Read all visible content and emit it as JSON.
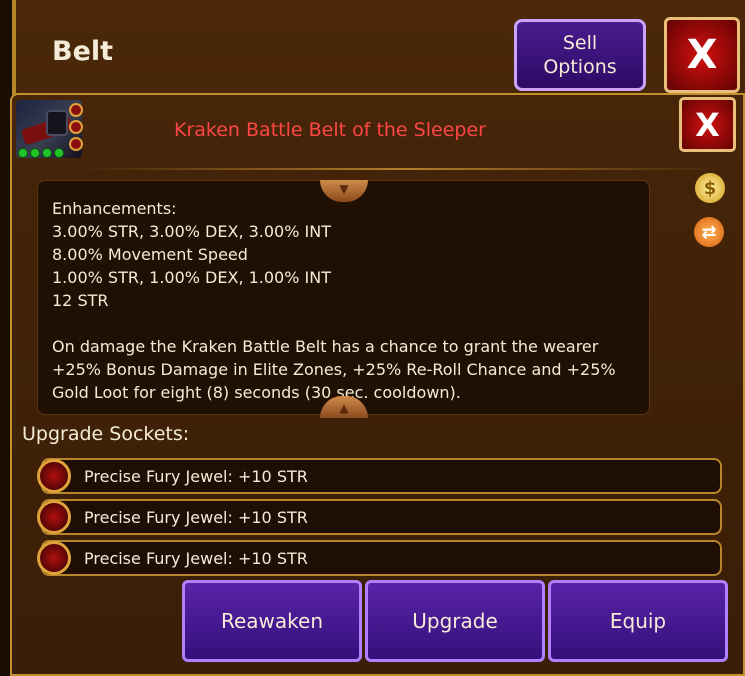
{
  "header": {
    "title": "Belt",
    "sell_label": "Sell\nOptions",
    "close_label": "X"
  },
  "item": {
    "name": "Kraken Battle Belt of the Sleeper",
    "close_label": "X",
    "name_color": "#ff4646",
    "description_lines": [
      "Enhancements:",
      "3.00% STR, 3.00% DEX, 3.00% INT",
      "8.00% Movement Speed",
      "1.00% STR, 1.00% DEX, 1.00% INT",
      "12 STR"
    ],
    "description_para": "On damage the Kraken Battle Belt has a chance to grant the wearer +25% Bonus Damage in Elite Zones, +25% Re-Roll Chance and +25% Gold Loot for eight (8) seconds (30 sec. cooldown)."
  },
  "side_icons": [
    "gold-bag-icon",
    "refresh-icon"
  ],
  "sockets": {
    "title": "Upgrade Sockets:",
    "items": [
      {
        "label": "Precise Fury Jewel: +10 STR"
      },
      {
        "label": "Precise Fury Jewel: +10 STR"
      },
      {
        "label": "Precise Fury Jewel: +10 STR"
      }
    ]
  },
  "actions": {
    "reawaken": "Reawaken",
    "upgrade": "Upgrade",
    "equip": "Equip"
  }
}
